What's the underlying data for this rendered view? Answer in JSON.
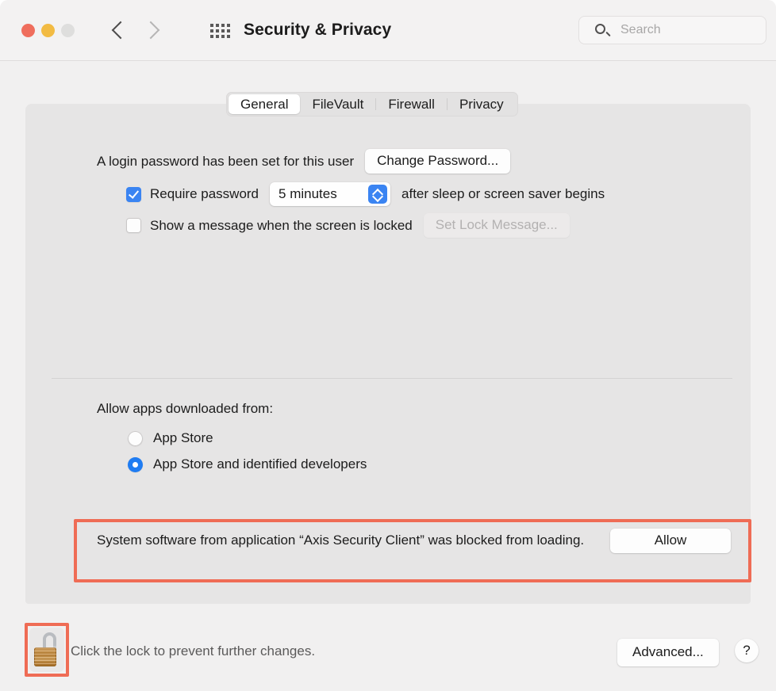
{
  "window": {
    "title": "Security & Privacy",
    "traffic_lights": [
      {
        "name": "close",
        "color": "#ef6e5d"
      },
      {
        "name": "minimize",
        "color": "#f2bb43"
      },
      {
        "name": "zoom",
        "color": "#dededd"
      }
    ],
    "nav": {
      "back_icon": "chevron-left-icon",
      "forward_icon": "chevron-right-icon",
      "grid_icon": "show-all-grid-icon"
    },
    "search": {
      "placeholder": "Search",
      "value": "",
      "icon": "search-icon"
    }
  },
  "tabs": [
    {
      "label": "General",
      "active": true
    },
    {
      "label": "FileVault",
      "active": false
    },
    {
      "label": "Firewall",
      "active": false
    },
    {
      "label": "Privacy",
      "active": false
    }
  ],
  "general": {
    "login_password_text": "A login password has been set for this user",
    "change_password_label": "Change Password...",
    "require_password": {
      "checked": true,
      "label": "Require password",
      "delay_value": "5 minutes",
      "suffix": "after sleep or screen saver begins"
    },
    "show_message": {
      "checked": false,
      "label": "Show a message when the screen is locked",
      "button_label": "Set Lock Message...",
      "button_disabled": true
    },
    "allow_apps": {
      "title": "Allow apps downloaded from:",
      "options": [
        {
          "label": "App Store",
          "selected": false
        },
        {
          "label": "App Store and identified developers",
          "selected": true
        }
      ]
    },
    "blocked_alert": {
      "message": "System software from application “Axis Security Client” was blocked from loading.",
      "action_label": "Allow",
      "highlight_color": "#ef6c55"
    }
  },
  "footer": {
    "lock_icon": "unlocked-padlock-icon",
    "lock_state": "unlocked",
    "lock_caption": "Click the lock to prevent further changes.",
    "advanced_label": "Advanced...",
    "help_label": "?",
    "highlight_color": "#ef6c55"
  },
  "colors": {
    "accent": "#3a84f2",
    "window_bg": "#f1f0f0",
    "panel_bg": "#e6e5e5",
    "annotation_red": "#ef6c55"
  }
}
